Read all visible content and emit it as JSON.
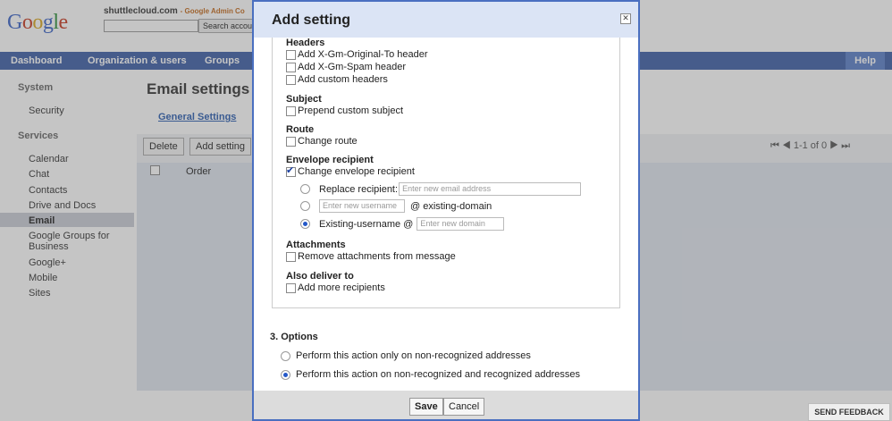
{
  "header": {
    "logo": "Google",
    "domain": "shuttlecloud.com",
    "domain_suffix": "- Google Admin Co",
    "search_button": "Search accou"
  },
  "nav": {
    "dashboard": "Dashboard",
    "org": "Organization & users",
    "groups": "Groups",
    "help": "Help"
  },
  "sidebar": {
    "system": "System",
    "security": "Security",
    "services": "Services",
    "items": [
      "Calendar",
      "Chat",
      "Contacts",
      "Drive and Docs",
      "Email",
      "Google Groups for",
      "Business",
      "Google+",
      "Mobile",
      "Sites"
    ]
  },
  "main": {
    "title": "Email settings",
    "tab_general": "General Settings",
    "delete": "Delete",
    "add_setting": "Add setting",
    "order": "Order",
    "paging": "1-1 of 0"
  },
  "feedback": "SEND FEEDBACK",
  "dialog": {
    "title": "Add setting",
    "close": "✕",
    "headers": "Headers",
    "h1": "Add X-Gm-Original-To header",
    "h2": "Add X-Gm-Spam header",
    "h3": "Add custom headers",
    "subject": "Subject",
    "s1": "Prepend custom subject",
    "route": "Route",
    "r1": "Change route",
    "envelope": "Envelope recipient",
    "e1": "Change envelope recipient",
    "replace_label": "Replace recipient:",
    "replace_ph": "Enter new email address",
    "username_ph": "Enter new username",
    "existing_domain": "@ existing-domain",
    "existing_username": "Existing-username @",
    "domain_ph": "Enter new domain",
    "attachments": "Attachments",
    "a1": "Remove attachments from message",
    "also": "Also deliver to",
    "d1": "Add more recipients",
    "options": "3. Options",
    "opt1": "Perform this action only on non-recognized addresses",
    "opt2": "Perform this action on non-recognized and recognized addresses",
    "save": "Save",
    "cancel": "Cancel"
  }
}
